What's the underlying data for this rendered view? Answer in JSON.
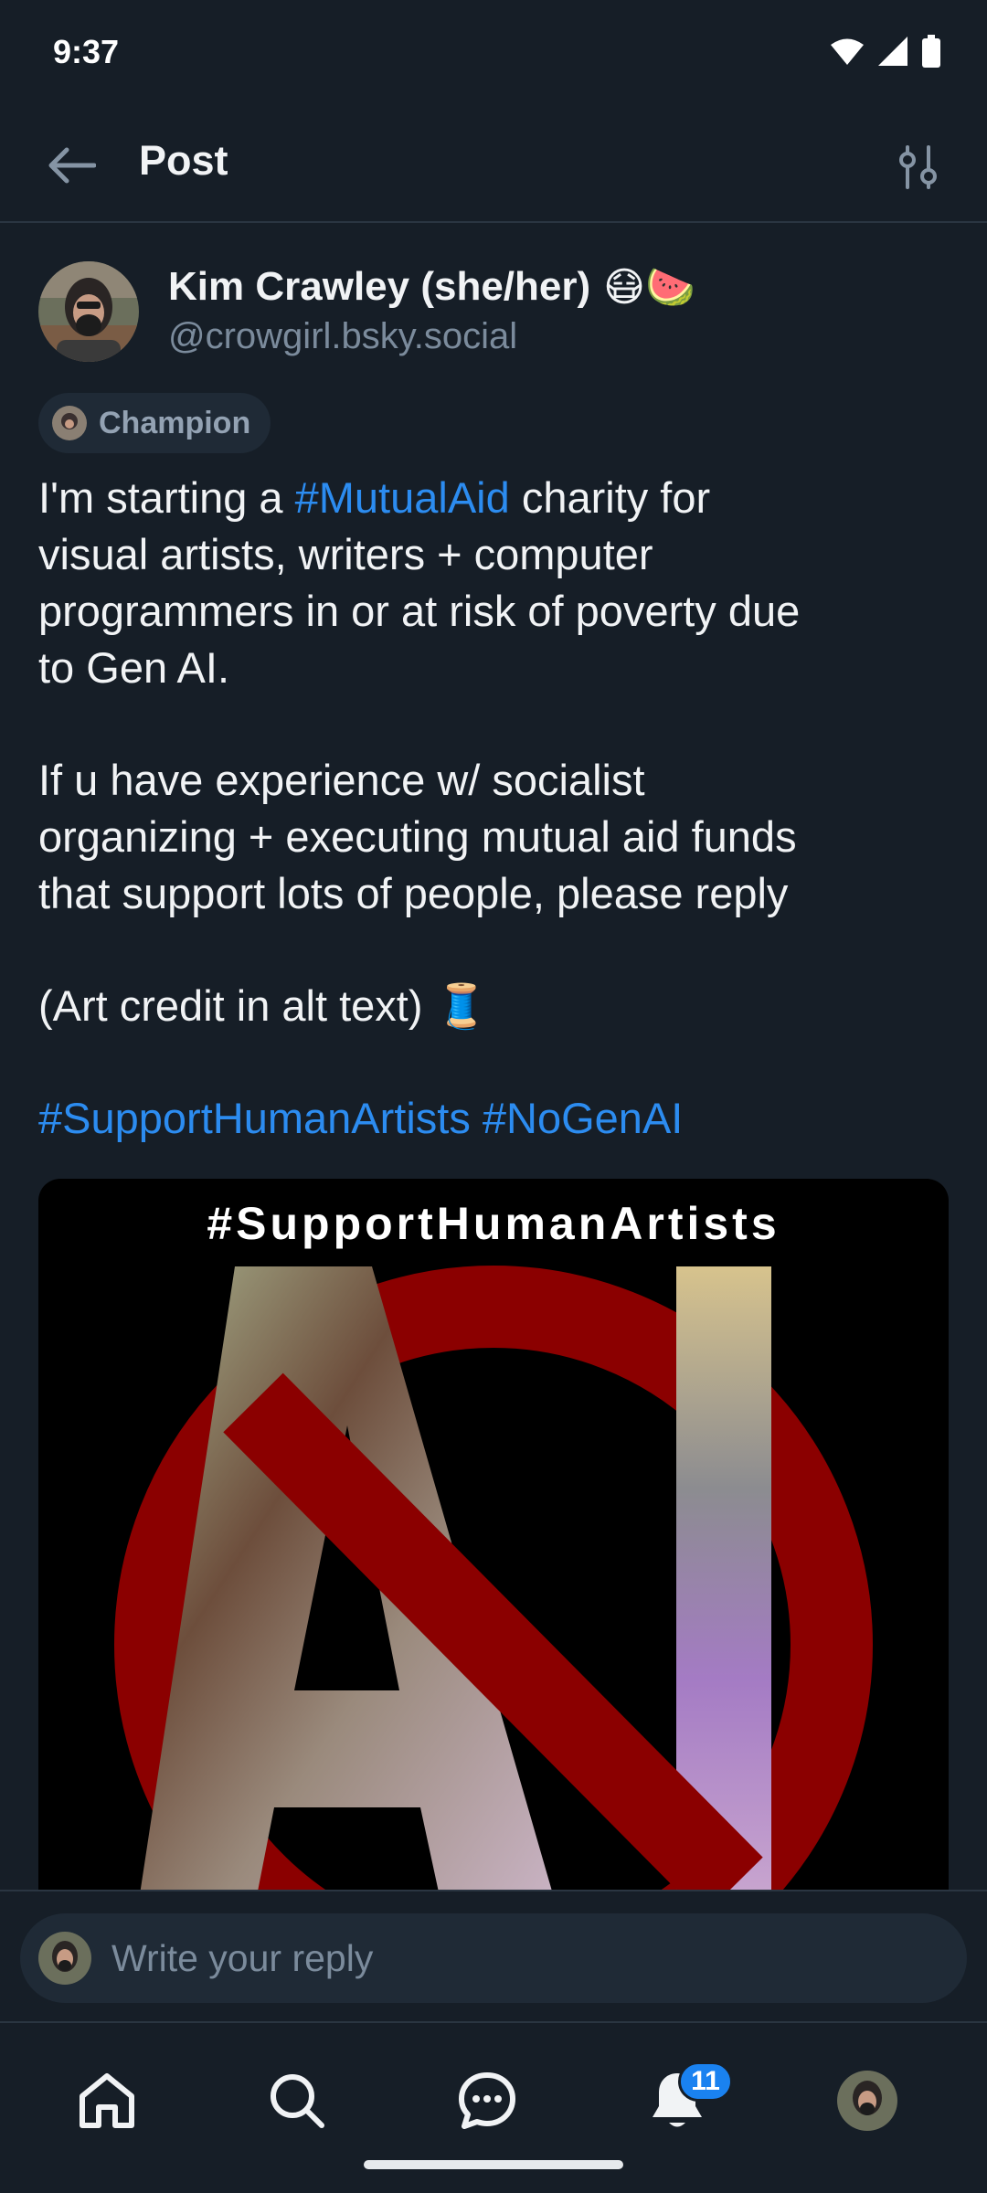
{
  "status_bar": {
    "time": "9:37"
  },
  "header": {
    "title": "Post"
  },
  "author": {
    "name": "Kim Crawley (she/her)",
    "emojis": "😷🍉",
    "handle": "@crowgirl.bsky.social",
    "badge": "Champion"
  },
  "post": {
    "line1_pre": "I'm starting a ",
    "line1_tag": "#MutualAid",
    "line1_post": " charity for",
    "line2": "visual artists, writers + computer",
    "line3": "programmers in or at risk of poverty due",
    "line4": "to Gen AI.",
    "line5": "If u have experience w/ socialist",
    "line6": "organizing + executing mutual aid funds",
    "line7": "that support lots of people, please reply",
    "line8": "(Art credit in alt text) 🧵",
    "tag_support": "#SupportHumanArtists",
    "tag_nogenai": "#NoGenAI"
  },
  "image": {
    "caption": "#SupportHumanArtists",
    "colors": {
      "background": "#000000",
      "prohibition": "#8b0000"
    }
  },
  "reply": {
    "placeholder": "Write your reply"
  },
  "nav": {
    "notification_count": "11"
  },
  "colors": {
    "background": "#161e27",
    "accent": "#2c8cf0",
    "muted": "#7b8b9c",
    "surface": "#1f2a36"
  },
  "icons": [
    "back-arrow-icon",
    "sliders-icon",
    "home-icon",
    "search-icon",
    "chat-icon",
    "bell-icon"
  ]
}
